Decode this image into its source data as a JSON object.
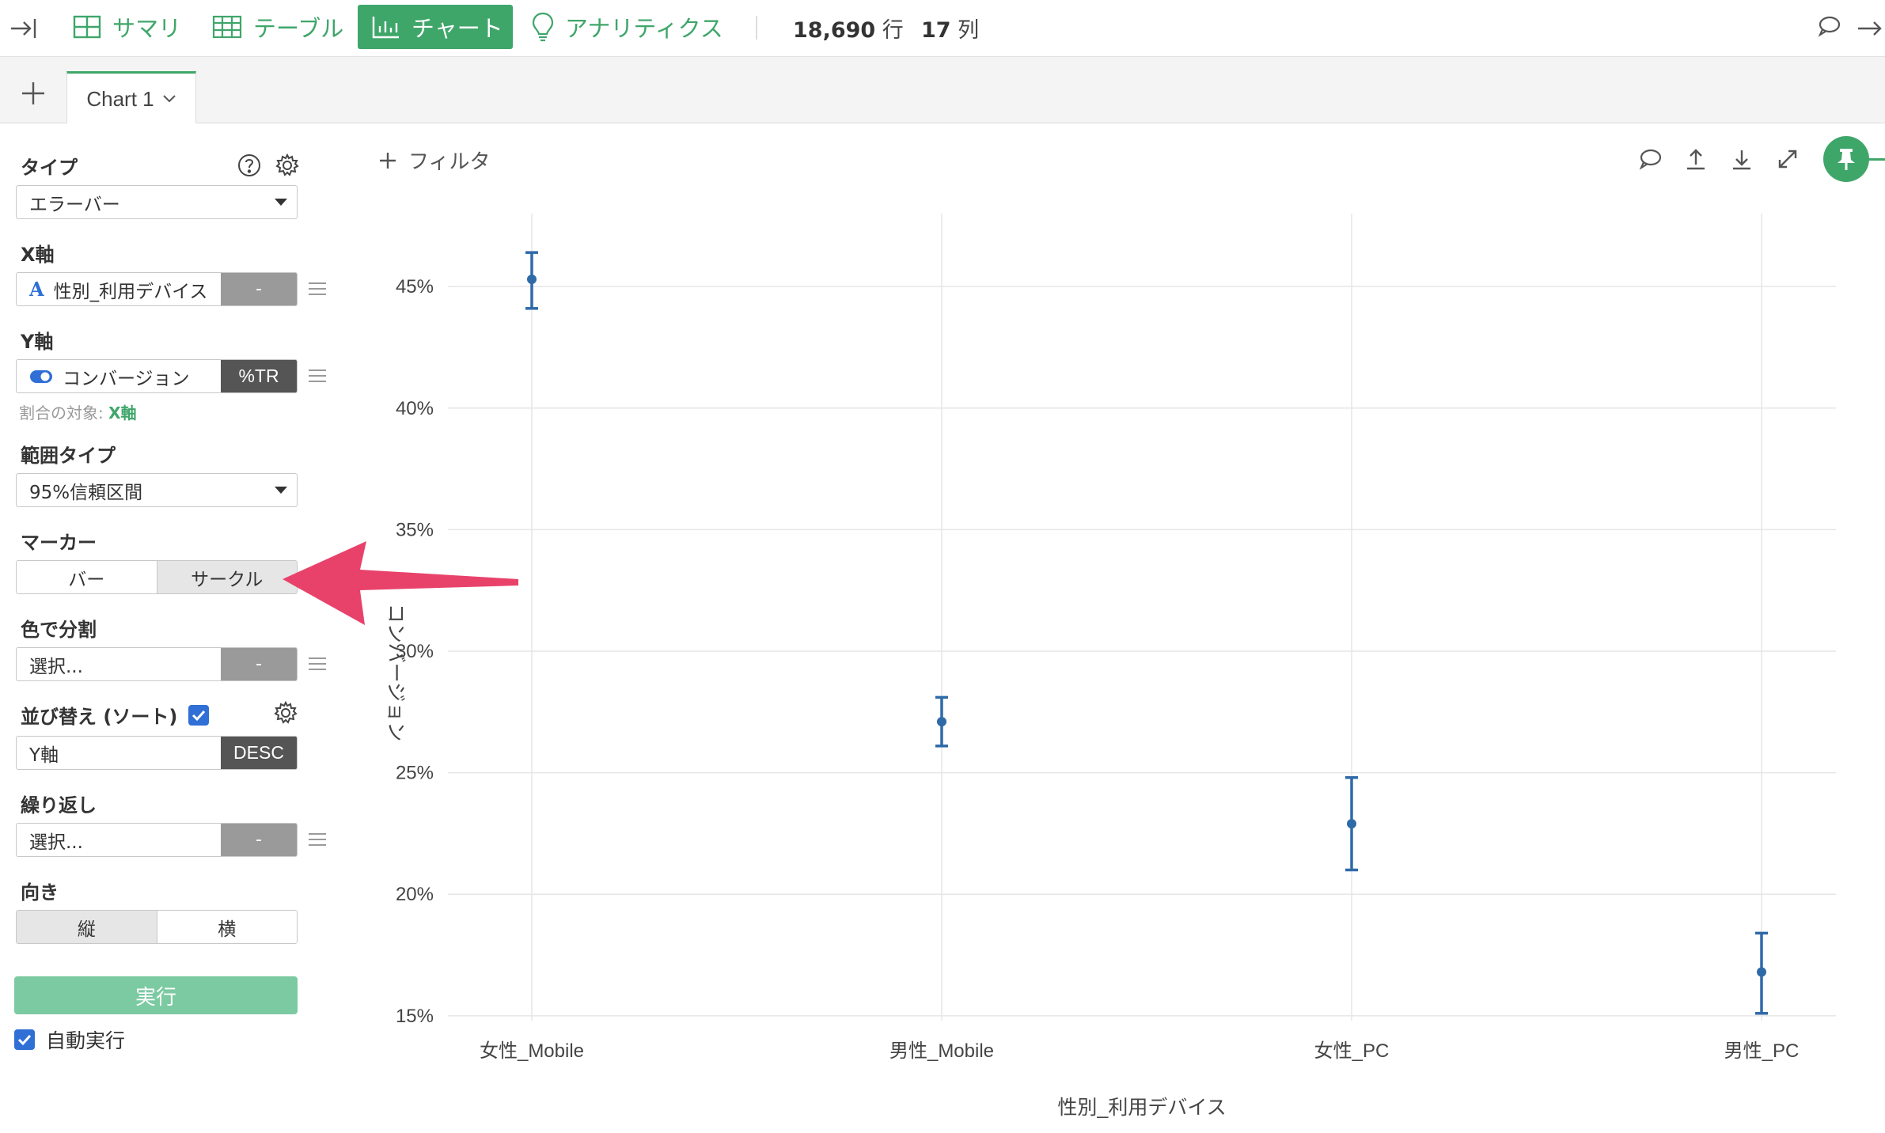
{
  "topbar": {
    "tabs": [
      {
        "label": "サマリ",
        "icon": "grid-icon"
      },
      {
        "label": "テーブル",
        "icon": "table-icon"
      },
      {
        "label": "チャート",
        "icon": "bar-chart-icon",
        "active": true
      },
      {
        "label": "アナリティクス",
        "icon": "lightbulb-icon"
      }
    ],
    "rows": "18,690",
    "rows_unit": "行",
    "cols": "17",
    "cols_unit": "列"
  },
  "chart_tabs": {
    "active_label": "Chart 1"
  },
  "panel": {
    "type_label": "タイプ",
    "type_value": "エラーバー",
    "x_label": "X軸",
    "x_value": "性別_利用デバイス",
    "x_agg": "-",
    "y_label": "Y軸",
    "y_value": "コンバージョン",
    "y_agg": "%TR",
    "ratio_prefix": "割合の対象: ",
    "ratio_target": "X軸",
    "range_label": "範囲タイプ",
    "range_value": "95%信頼区間",
    "marker_label": "マーカー",
    "marker_options": [
      "バー",
      "サークル"
    ],
    "marker_selected": "サークル",
    "color_label": "色で分割",
    "color_value": "選択...",
    "color_agg": "-",
    "sort_label": "並び替え (ソート)",
    "sort_value": "Y軸",
    "sort_order": "DESC",
    "repeat_label": "繰り返し",
    "repeat_value": "選択...",
    "repeat_agg": "-",
    "orient_label": "向き",
    "orient_options": [
      "縦",
      "横"
    ],
    "orient_selected": "縦",
    "run_label": "実行",
    "auto_label": "自動実行"
  },
  "toolbar": {
    "filter_label": "フィルタ"
  },
  "colors": {
    "accent": "#3fa66a",
    "series": "#2f6aa8",
    "arrow": "#e8426b"
  },
  "chart_data": {
    "type": "errorbar",
    "categories": [
      "女性_Mobile",
      "男性_Mobile",
      "女性_PC",
      "男性_PC"
    ],
    "series": [
      {
        "values": [
          45.3,
          27.1,
          22.9,
          16.8
        ],
        "lower": [
          44.1,
          26.1,
          21.0,
          15.1
        ],
        "upper": [
          46.4,
          28.1,
          24.8,
          18.4
        ]
      }
    ],
    "xlabel": "性別_利用デバイス",
    "ylabel": "コンバージョン",
    "ylim": [
      14.8,
      48.0
    ],
    "yticks": [
      15,
      20,
      25,
      30,
      35,
      40,
      45
    ],
    "ytick_labels": [
      "15%",
      "20%",
      "25%",
      "30%",
      "35%",
      "40%",
      "45%"
    ],
    "grid": true
  }
}
